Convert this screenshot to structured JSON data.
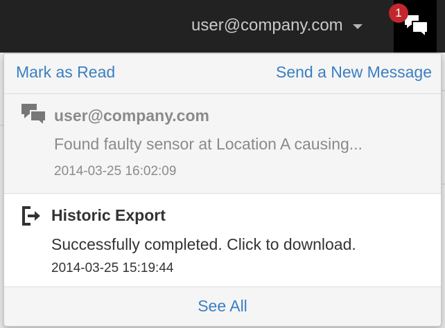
{
  "header": {
    "user_email": "user@company.com",
    "notification_count": "1"
  },
  "dropdown": {
    "mark_as_read_label": "Mark as Read",
    "send_message_label": "Send a New Message",
    "see_all_label": "See All",
    "notifications": [
      {
        "icon": "chat-bubbles-icon",
        "title": "user@company.com",
        "body": "Found faulty sensor at Location A causing...",
        "timestamp": "2014-03-25 16:02:09",
        "read": true
      },
      {
        "icon": "export-icon",
        "title": "Historic Export",
        "body": "Successfully completed. Click to download.",
        "timestamp": "2014-03-25 15:19:44",
        "read": false
      }
    ]
  },
  "colors": {
    "link": "#3a7fc1",
    "badge": "#c1272d",
    "topbar": "#222222"
  }
}
